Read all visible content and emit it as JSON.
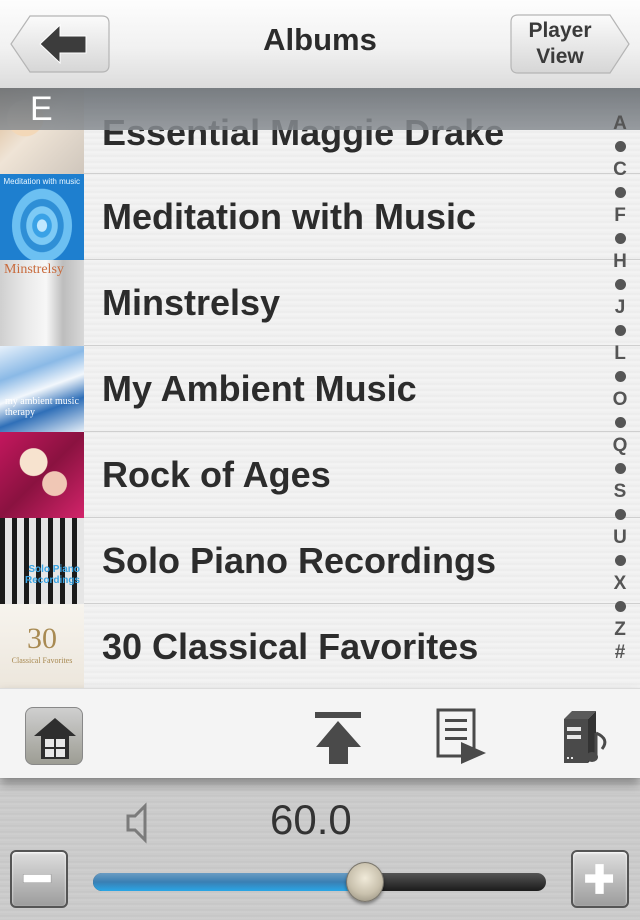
{
  "navbar": {
    "title": "Albums",
    "back_icon": "arrow-left-icon",
    "player_view_label_line1": "Player",
    "player_view_label_line2": "View"
  },
  "section_header": {
    "letter": "E"
  },
  "albums": [
    {
      "title": "Essential Maggie Drake",
      "art_text": ""
    },
    {
      "title": "Meditation with Music",
      "art_text": "Meditation with music"
    },
    {
      "title": "Minstrelsy",
      "art_text": "Minstrelsy"
    },
    {
      "title": "My Ambient Music",
      "art_text": "my ambient music therapy"
    },
    {
      "title": "Rock of Ages",
      "art_text": ""
    },
    {
      "title": "Solo Piano Recordings",
      "art_text": "Solo Piano Recordings"
    },
    {
      "title": "30 Classical Favorites",
      "art_text_big": "30",
      "art_text_small": "Classical Favorites"
    }
  ],
  "index": [
    "A",
    "•",
    "C",
    "•",
    "F",
    "•",
    "H",
    "•",
    "J",
    "•",
    "L",
    "•",
    "O",
    "•",
    "Q",
    "•",
    "S",
    "•",
    "U",
    "•",
    "X",
    "•",
    "Z",
    "#"
  ],
  "toolbar": {
    "home_icon": "home-icon",
    "scroll_top_icon": "scroll-to-top-icon",
    "playlist_icon": "playlist-play-icon",
    "media_server_icon": "media-server-icon"
  },
  "volume": {
    "value": "60.0",
    "fraction": 0.6,
    "minus_icon": "minus-icon",
    "plus_icon": "plus-icon",
    "speaker_icon": "speaker-icon",
    "fill_color": "#3a7fb3"
  }
}
